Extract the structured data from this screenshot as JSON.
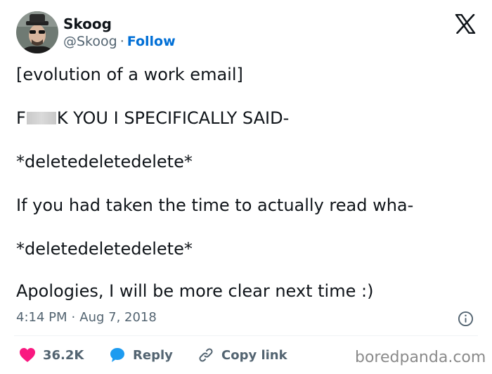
{
  "author": {
    "name": "Skoog",
    "handle": "@Skoog",
    "separator": "·",
    "follow_label": "Follow"
  },
  "tweet": {
    "line1": "[evolution of a work email]",
    "line2_before": "F",
    "line2_after": "K YOU I SPECIFICALLY SAID-",
    "line3": "*deletedeletedelete*",
    "line4": "If you had taken the time to actually read wha-",
    "line5": "*deletedeletedelete*",
    "line6": "Apologies, I will be more clear next time :)"
  },
  "meta": {
    "time": "4:14 PM",
    "separator": "·",
    "date": "Aug 7, 2018"
  },
  "actions": {
    "like_count": "36.2K",
    "reply_label": "Reply",
    "copy_label": "Copy link"
  },
  "watermark": "boredpanda.com",
  "colors": {
    "link_blue": "#006fd6",
    "heart_pink": "#f91880",
    "reply_blue": "#1d9bf0",
    "text": "#0f1419",
    "muted": "#536471"
  },
  "icons": [
    "x-logo-icon",
    "info-icon",
    "heart-icon",
    "reply-bubble-icon",
    "link-icon"
  ]
}
